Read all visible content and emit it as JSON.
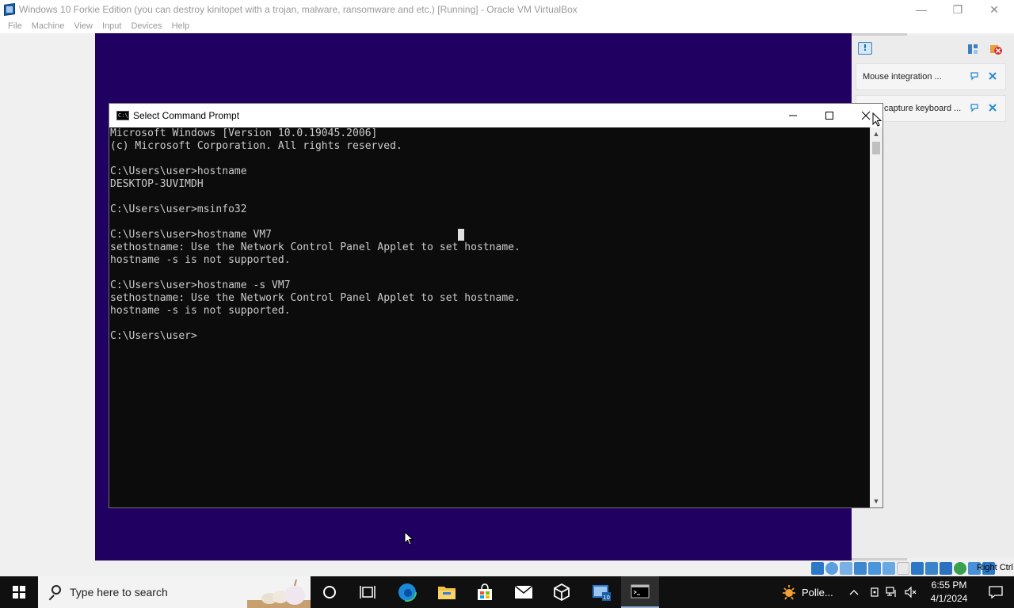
{
  "host_window": {
    "title": "Windows 10 Forkie Edition (you can destroy kinitopet with a trojan, malware, ransomware and etc.) [Running] - Oracle VM VirtualBox",
    "minimize": "—",
    "maximize": "❐",
    "close": "✕",
    "menu": [
      "File",
      "Machine",
      "View",
      "Input",
      "Devices",
      "Help"
    ]
  },
  "notifications": {
    "items": [
      {
        "text": "Mouse integration ..."
      },
      {
        "text": "capture keyboard ..."
      }
    ]
  },
  "cmd": {
    "title": "Select Command Prompt",
    "icon_text": "C:\\",
    "lines": [
      "Microsoft Windows [Version 10.0.19045.2006]",
      "(c) Microsoft Corporation. All rights reserved.",
      "",
      "C:\\Users\\user>hostname",
      "DESKTOP-3UVIMDH",
      "",
      "C:\\Users\\user>msinfo32",
      "",
      "C:\\Users\\user>hostname VM7",
      "sethostname: Use the Network Control Panel Applet to set hostname.",
      "hostname -s is not supported.",
      "",
      "C:\\Users\\user>hostname -s VM7",
      "sethostname: Use the Network Control Panel Applet to set hostname.",
      "hostname -s is not supported.",
      "",
      "C:\\Users\\user>"
    ]
  },
  "status_bar": {
    "host_key": "Right Ctrl"
  },
  "taskbar": {
    "search_placeholder": "Type here to search",
    "weather_text": "Polle...",
    "time": "6:55 PM",
    "date": "4/1/2024"
  },
  "colors": {
    "guest_desktop": "#200060",
    "console_bg": "#0c0c0c",
    "console_text": "#cccccc",
    "taskbar": "#101010"
  }
}
